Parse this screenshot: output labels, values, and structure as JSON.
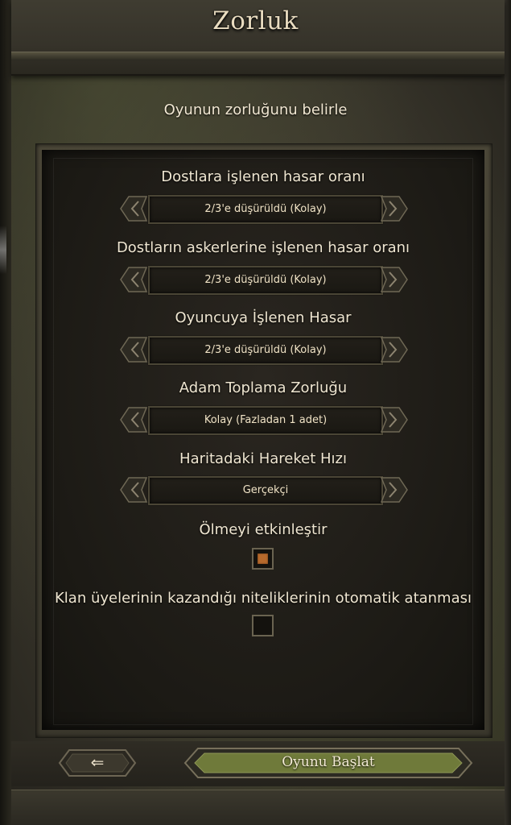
{
  "title": "Zorluk",
  "subtitle": "Oyunun zorluğunu belirle",
  "settings": [
    {
      "label": "Dostlara işlenen hasar oranı",
      "value": "2/3'e düşürüldü (Kolay)"
    },
    {
      "label": "Dostların askerlerine işlenen hasar oranı",
      "value": "2/3'e düşürüldü (Kolay)"
    },
    {
      "label": "Oyuncuya İşlenen Hasar",
      "value": "2/3'e düşürüldü (Kolay)"
    },
    {
      "label": "Adam Toplama Zorluğu",
      "value": "Kolay (Fazladan 1 adet)"
    },
    {
      "label": "Haritadaki Hareket Hızı",
      "value": "Gerçekçi"
    }
  ],
  "checkboxes": [
    {
      "label": "Ölmeyi etkinleştir",
      "checked": true
    },
    {
      "label": "Klan üyelerinin kazandığı niteliklerinin otomatik atanması",
      "checked": false
    }
  ],
  "footer": {
    "back_icon": "left-arrow-icon",
    "back_glyph": "⇐",
    "start_label": "Oyunu Başlat"
  },
  "colors": {
    "accent_checkbox": "#b86a2c",
    "start_button": "#6f7a3a"
  }
}
